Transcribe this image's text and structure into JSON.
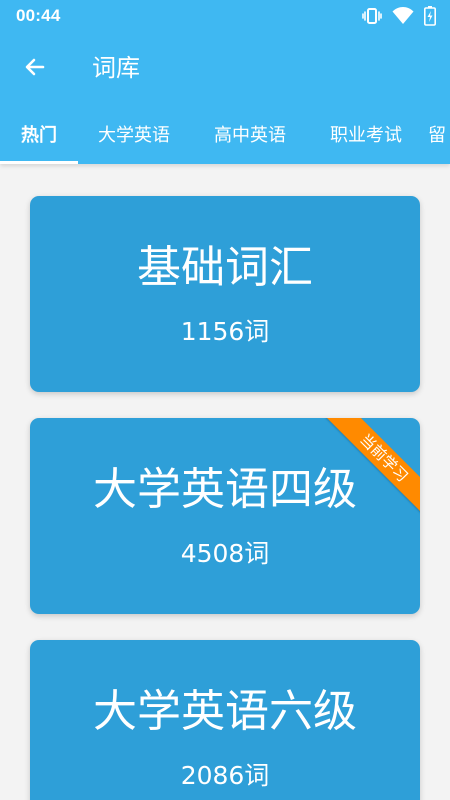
{
  "statusbar": {
    "time": "00:44",
    "icons": [
      "vibrate-icon",
      "wifi-icon",
      "battery-charging-icon"
    ]
  },
  "appbar": {
    "title": "词库",
    "back_icon": "arrow-left-icon"
  },
  "tabs": [
    {
      "label": "热门",
      "active": true
    },
    {
      "label": "大学英语",
      "active": false
    },
    {
      "label": "高中英语",
      "active": false
    },
    {
      "label": "职业考试",
      "active": false
    },
    {
      "label": "留",
      "active": false
    }
  ],
  "cards": [
    {
      "title": "基础词汇",
      "count": "1156词"
    },
    {
      "title": "大学英语四级",
      "count": "4508词",
      "ribbon": "当前学习"
    },
    {
      "title": "大学英语六级",
      "count": "2086词"
    }
  ],
  "colors": {
    "header": "#3fb8f2",
    "card": "#2e9fd8",
    "ribbon": "#ff8a00",
    "background": "#f3f3f3"
  }
}
